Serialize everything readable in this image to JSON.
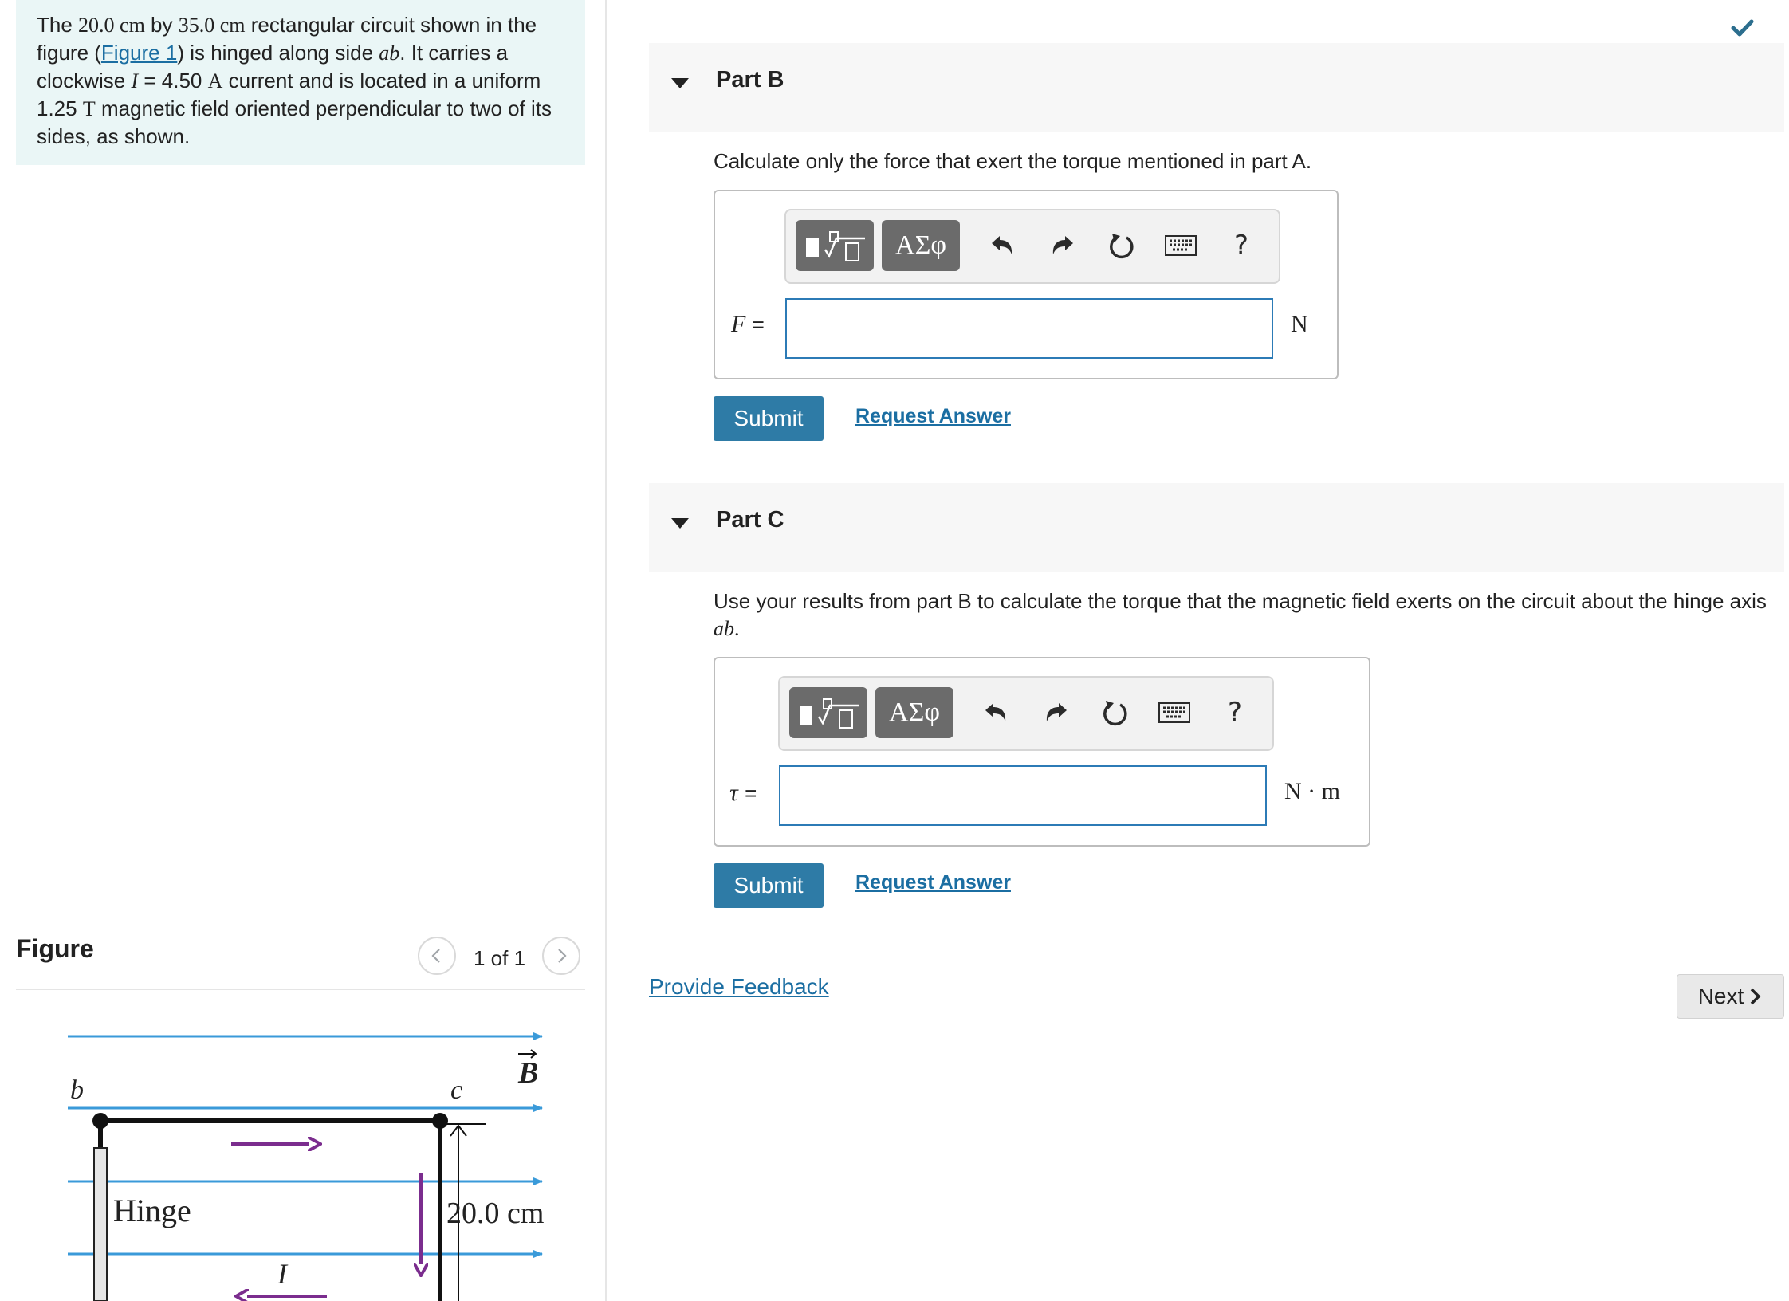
{
  "problem": {
    "t1": "The ",
    "m1": "20.0 cm",
    "t2": " by ",
    "m2": "35.0 cm",
    "t3": " rectangular circuit shown in the figure (",
    "figure_link": "Figure 1",
    "t4": ") is hinged along side ",
    "m3": "ab",
    "t5": ". It carries a clockwise ",
    "m4": "I",
    "t6": " = 4.50 ",
    "m5": "A",
    "t7": " current and is located in a uniform 1.25 ",
    "m6": "T",
    "t8": " magnetic field oriented perpendicular to two of its sides, as shown."
  },
  "figure": {
    "title": "Figure",
    "counter": "1 of 1",
    "labels": {
      "b": "b",
      "c": "c",
      "B": "B",
      "hinge": "Hinge",
      "dim": "20.0 cm",
      "I": "I"
    }
  },
  "partB": {
    "title": "Part B",
    "question": "Calculate only the force that exert the torque mentioned in part A.",
    "variable": "F",
    "equals": "=",
    "unit": "N",
    "input_value": "",
    "submit": "Submit",
    "request": "Request Answer"
  },
  "partC": {
    "title": "Part C",
    "question_text": "Use your results from part B to calculate the torque that the magnetic field exerts on the circuit about the hinge axis ",
    "question_math": "ab",
    "question_end": ".",
    "variable": "τ",
    "equals": "=",
    "unit": "N · m",
    "input_value": "",
    "submit": "Submit",
    "request": "Request Answer"
  },
  "toolbar": {
    "greek": "ΑΣφ",
    "help": "?"
  },
  "footer": {
    "feedback": "Provide Feedback",
    "next": "Next"
  },
  "colors": {
    "accent": "#2e7ba6",
    "link": "#1b6ea2",
    "field_line": "#3a9ad9",
    "current_arrow": "#7b2d8e",
    "problem_bg": "#eaf6f6"
  },
  "icons": [
    "check-icon",
    "templates-icon",
    "greek-icon",
    "undo-icon",
    "redo-icon",
    "reset-icon",
    "keyboard-icon",
    "help-icon",
    "chevron-left-icon",
    "chevron-right-icon",
    "triangle-down-icon"
  ]
}
